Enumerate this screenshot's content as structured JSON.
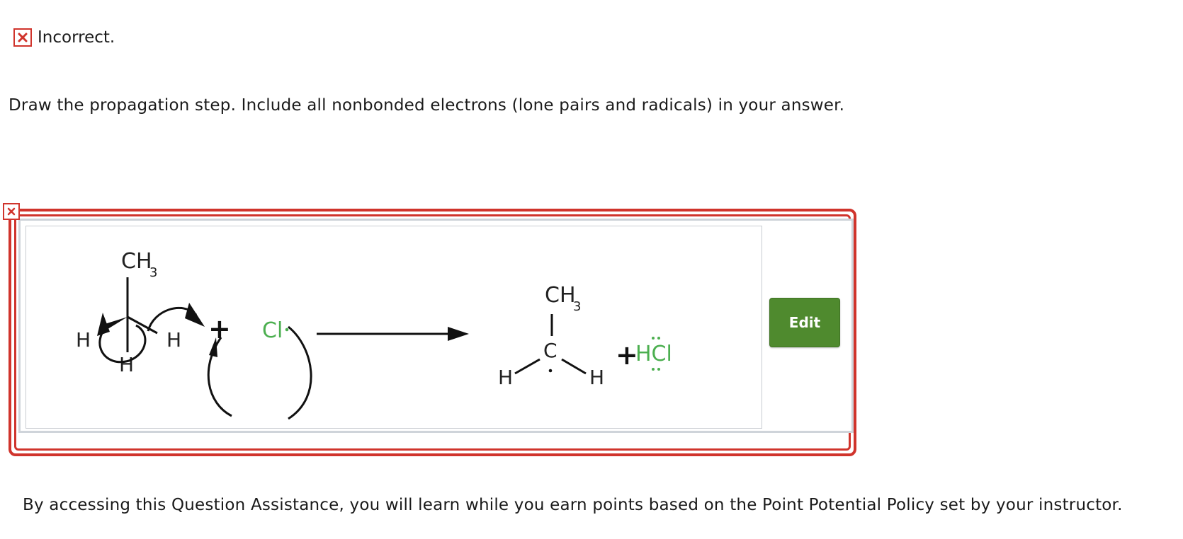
{
  "status": {
    "text": "Incorrect."
  },
  "question": {
    "prompt": "Draw the propagation step. Include all nonbonded electrons (lone pairs and radicals) in your answer."
  },
  "answer": {
    "edit_label": "Edit",
    "reactant": {
      "top_group": "CH",
      "top_sub": "3",
      "left_h": "H",
      "right_h": "H",
      "bottom_h": "H"
    },
    "plus_1": "+",
    "chlorine": "Cl",
    "product": {
      "top_group": "CH",
      "top_sub": "3",
      "center": "C",
      "left_h": "H",
      "right_h": "H"
    },
    "plus_2": "+",
    "hcl": "HCl"
  },
  "footer": {
    "text": "By accessing this Question Assistance, you will learn while you earn points based on the Point Potential Policy set by your instructor."
  },
  "colors": {
    "error_red": "#d0342c",
    "edit_green": "#4f8a2e",
    "chlorine_green": "#4caf50"
  }
}
